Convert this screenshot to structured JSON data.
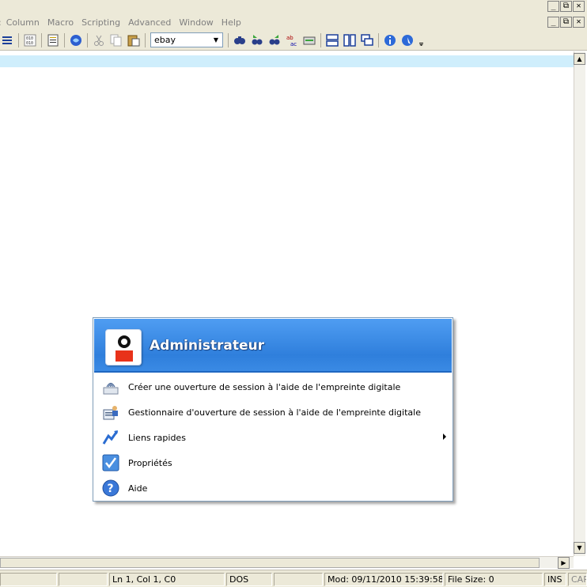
{
  "menubar": {
    "items": [
      "Column",
      "Macro",
      "Scripting",
      "Advanced",
      "Window",
      "Help"
    ],
    "window_controls": [
      "_",
      "⧉",
      "✕"
    ]
  },
  "toolbar": {
    "search_combo_value": "ebay"
  },
  "popup": {
    "user_name": "Administrateur",
    "items": [
      {
        "label": "Créer une ouverture de session à l'aide de l'empreinte digitale",
        "icon": "fingerprint-icon"
      },
      {
        "label": "Gestionnaire d'ouverture de session à l'aide de l'empreinte digitale",
        "icon": "user-manager-icon"
      },
      {
        "label": "Liens rapides",
        "icon": "quick-links-icon",
        "has_submenu": true
      },
      {
        "label": "Propriétés",
        "icon": "checkbox-properties-icon"
      },
      {
        "label": "Aide",
        "icon": "help-icon"
      }
    ]
  },
  "statusbar": {
    "position": "Ln 1, Col 1, C0",
    "line_ending": "DOS",
    "modified": "Mod: 09/11/2010 15:39:58",
    "file_size": "File Size: 0",
    "insert_mode": "INS",
    "caps": "CAP"
  },
  "colors": {
    "header_blue": "#2f7fdc",
    "current_line": "#cfeefc",
    "chrome": "#ece9d8"
  }
}
